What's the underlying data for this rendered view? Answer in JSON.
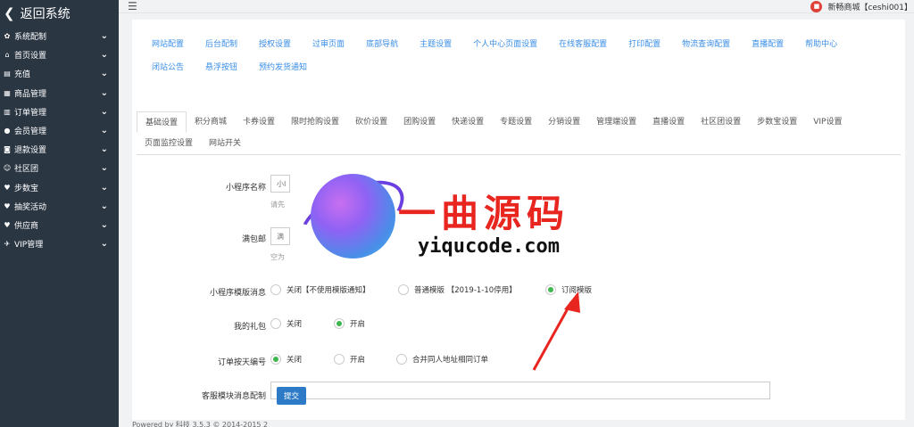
{
  "sidebar": {
    "back_label": "返回系统",
    "items": [
      {
        "icon": "gear-icon",
        "glyph": "✿",
        "label": "系统配制"
      },
      {
        "icon": "home-icon",
        "glyph": "⌂",
        "label": "首页设置"
      },
      {
        "icon": "recharge-icon",
        "glyph": "▤",
        "label": "充值"
      },
      {
        "icon": "goods-icon",
        "glyph": "▦",
        "label": "商品管理"
      },
      {
        "icon": "order-icon",
        "glyph": "▥",
        "label": "订单管理"
      },
      {
        "icon": "member-icon",
        "glyph": "●",
        "label": "会员管理"
      },
      {
        "icon": "refund-icon",
        "glyph": "◙",
        "label": "退款设置"
      },
      {
        "icon": "community-icon",
        "glyph": "☺",
        "label": "社区团"
      },
      {
        "icon": "heart-icon",
        "glyph": "♥",
        "label": "步数宝"
      },
      {
        "icon": "heart-icon",
        "glyph": "♥",
        "label": "抽奖活动"
      },
      {
        "icon": "heart-icon",
        "glyph": "♥",
        "label": "供应商"
      },
      {
        "icon": "plane-icon",
        "glyph": "✈",
        "label": "VIP管理"
      }
    ]
  },
  "topbar": {
    "user_label": "新畅商城【ceshi001】"
  },
  "tabs_primary": [
    [
      "网站配置",
      "后台配制",
      "授权设置",
      "过审页面",
      "底部导航",
      "主题设置",
      "个人中心页面设置",
      "在线客服配置",
      "打印配置",
      "物流查询配置",
      "直播配置",
      "帮助中心"
    ],
    [
      "闭站公告",
      "悬浮按钮",
      "预约发货通知"
    ]
  ],
  "tabs_secondary": [
    [
      "基础设置",
      "积分商城",
      "卡券设置",
      "限时抢购设置",
      "砍价设置",
      "团购设置",
      "快递设置",
      "专题设置",
      "分销设置",
      "管理端设置",
      "直播设置",
      "社区团设置",
      "步数宝设置",
      "VIP设置"
    ],
    [
      "页面监控设置",
      "网站开关"
    ]
  ],
  "form": {
    "miniapp_name": {
      "label": "小程序名称",
      "value": "小I",
      "help": "请先"
    },
    "free_shipping": {
      "label": "满包邮",
      "value": "满",
      "help": "空为"
    },
    "template_msg": {
      "label": "小程序模版消息",
      "options": [
        "关闭【不使用模版通知】",
        "普通模版 【2019-1-10停用】",
        "订阅模版"
      ],
      "selected": 2
    },
    "my_gift": {
      "label": "我的礼包",
      "options": [
        "关闭",
        "开启"
      ],
      "selected": 1
    },
    "order_daily_no": {
      "label": "订单按天编号",
      "options": [
        "关闭",
        "开启",
        "合并同人地址相同订单"
      ],
      "selected": 0
    },
    "cs_module": {
      "label": "客服模块消息配制"
    },
    "submit_label": "提交"
  },
  "footer": {
    "text": "Powered by 科技  3.5.3 © 2014-2015  2"
  },
  "watermark": {
    "cn": "一曲源码",
    "url": "yiqucode.com"
  },
  "colors": {
    "sidebar_bg": "#2b3643",
    "tab_link": "#3a8ee6",
    "radio_on": "#3fb74e",
    "submit_bg": "#2d7bc7",
    "watermark_red": "#e8251f",
    "arrow_red": "#e8251f"
  }
}
